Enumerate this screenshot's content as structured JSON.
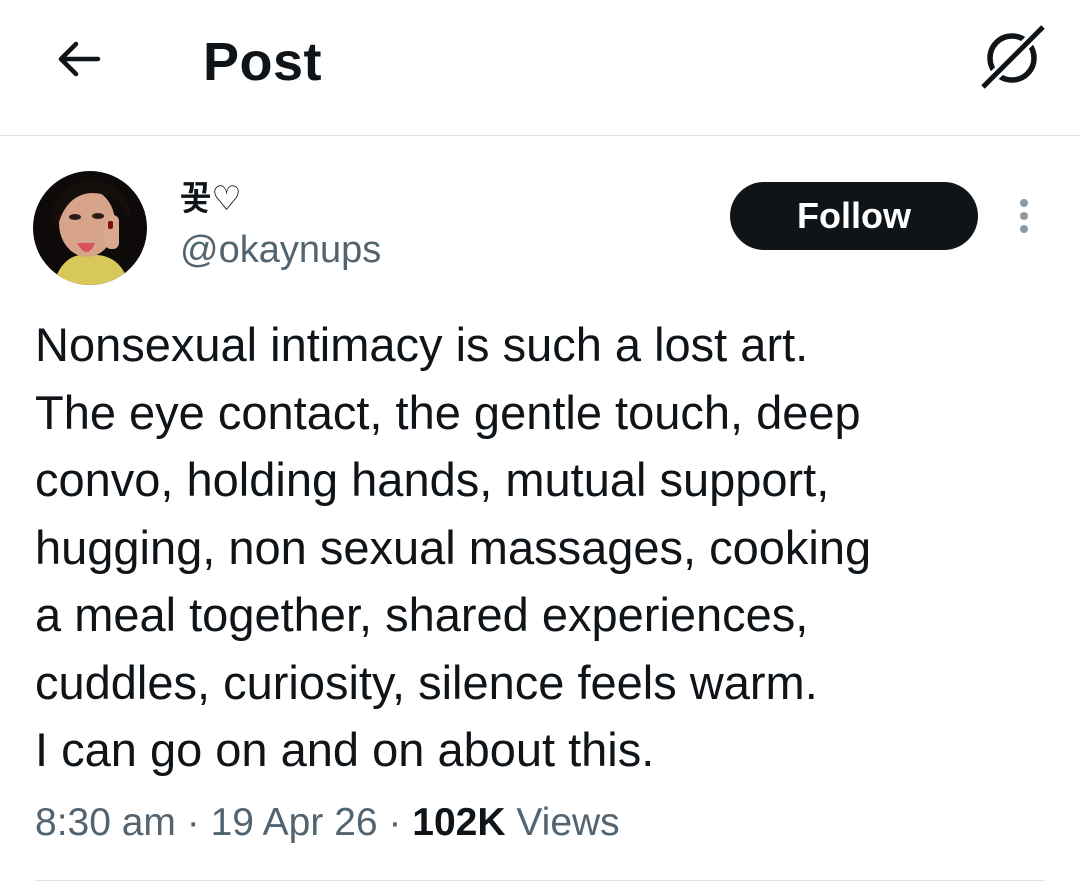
{
  "header": {
    "title": "Post",
    "back_icon": "arrow-left-icon",
    "grok_icon": "grok-icon"
  },
  "post": {
    "author": {
      "display_name": "꽃♡",
      "handle": "@okaynups"
    },
    "follow_label": "Follow",
    "more_icon": "more-vertical-icon",
    "text": "Nonsexual intimacy is such a lost art.\nThe eye contact, the gentle touch, deep\nconvo, holding hands, mutual support,\nhugging, non sexual massages, cooking\na meal together, shared experiences,\ncuddles, curiosity, silence feels warm.\nI can go on and on about this.",
    "time": "8:30 am",
    "date": "19 Apr 26",
    "separator": "·",
    "views_count": "102K",
    "views_label": "Views"
  },
  "colors": {
    "text_primary": "#0f1419",
    "text_secondary": "#536471",
    "divider": "#dfe3e6",
    "follow_bg": "#0f1419"
  }
}
